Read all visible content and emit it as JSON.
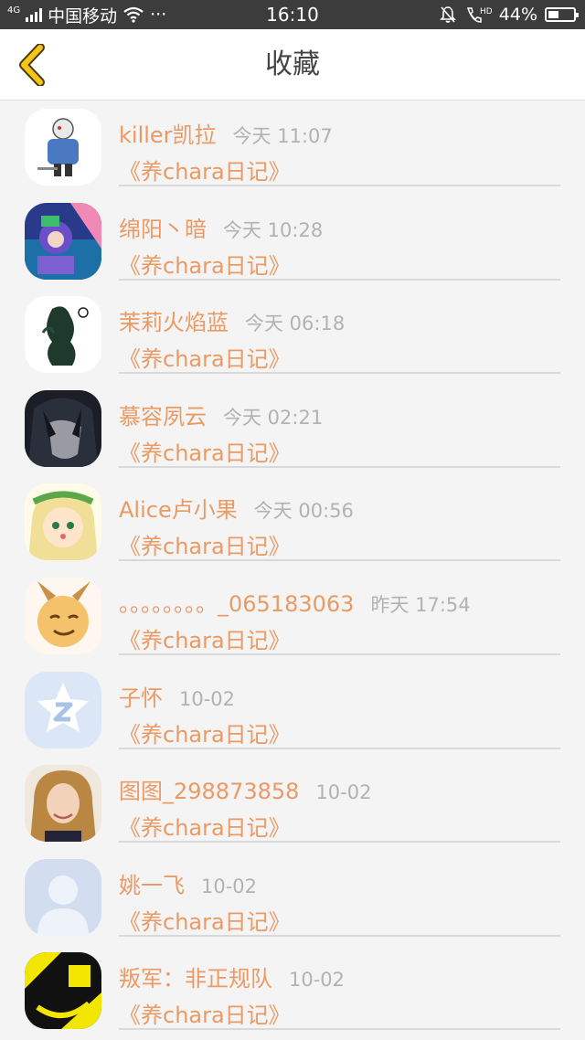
{
  "status_bar": {
    "network": "4G",
    "carrier": "中国移动",
    "more": "···",
    "time": "16:10",
    "battery": "44%",
    "battery_level": 0.44,
    "icons": [
      "signal-icon",
      "wifi-icon",
      "mute-icon",
      "hd-call-icon",
      "battery-icon"
    ]
  },
  "header": {
    "title": "收藏",
    "back_icon": "chevron-left-icon",
    "accent": "#f5c518"
  },
  "colors": {
    "name": "#eb9a64",
    "time": "#b2b2b2",
    "divider": "#d9d9d9"
  },
  "items": [
    {
      "name": "killer凯拉",
      "time": "今天 11:07",
      "title": "《养chara日记》"
    },
    {
      "name": "绵阳丶暗",
      "time": "今天 10:28",
      "title": "《养chara日记》"
    },
    {
      "name": "茉莉火焰蓝",
      "time": "今天 06:18",
      "title": "《养chara日记》"
    },
    {
      "name": "慕容夙云",
      "time": "今天 02:21",
      "title": "《养chara日记》"
    },
    {
      "name": "Alice卢小果",
      "time": "今天 00:56",
      "title": "《养chara日记》"
    },
    {
      "name": "。。。。。。。。_065183063",
      "time": "昨天 17:54",
      "title": "《养chara日记》"
    },
    {
      "name": "子怀",
      "time": "10-02",
      "title": "《养chara日记》"
    },
    {
      "name": "图图_298873858",
      "time": "10-02",
      "title": "《养chara日记》"
    },
    {
      "name": "姚一飞",
      "time": "10-02",
      "title": "《养chara日记》"
    },
    {
      "name": "叛军：非正规队",
      "time": "10-02",
      "title": "《养chara日记》"
    }
  ]
}
